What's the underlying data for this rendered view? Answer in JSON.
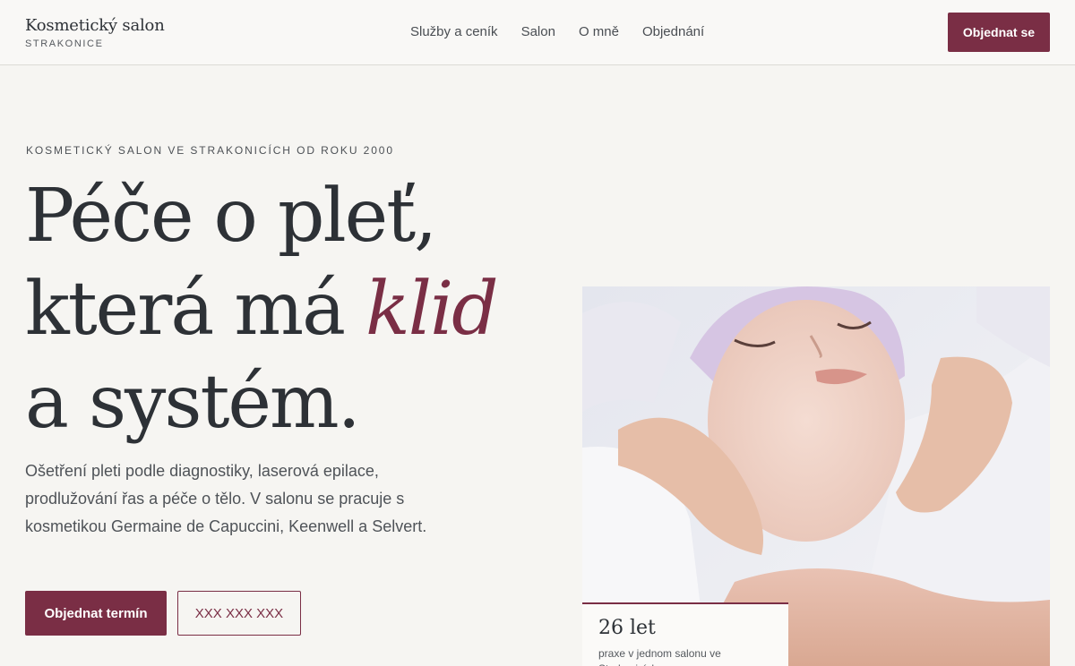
{
  "header": {
    "brand_name": "Kosmetický salon",
    "brand_city": "STRAKONICE",
    "nav": [
      {
        "label": "Služby a ceník"
      },
      {
        "label": "Salon"
      },
      {
        "label": "O mně"
      },
      {
        "label": "Objednání"
      }
    ],
    "cta_label": "Objednat se"
  },
  "hero": {
    "eyebrow": "KOSMETICKÝ SALON VE STRAKONICÍCH OD ROKU 2000",
    "headline_line1": "Péče o pleť,",
    "headline_line2_pre": "která má ",
    "headline_line2_accent": "klid",
    "headline_line3": "a systém.",
    "lede": "Ošetření pleti podle diagnostiky, laserová epilace, prodlužování řas a péče o tělo. V salonu se pracuje s kosmetikou Germaine de Capuccini, Keenwell a Selvert.",
    "primary_button": "Objednat termín",
    "phone_button": "XXX XXX XXX",
    "stat_value": "26 let",
    "stat_label": "praxe v jednom salonu ve Strakonicích"
  },
  "colors": {
    "accent": "#7a2e45",
    "background": "#f6f5f2",
    "text": "#2d3136"
  }
}
